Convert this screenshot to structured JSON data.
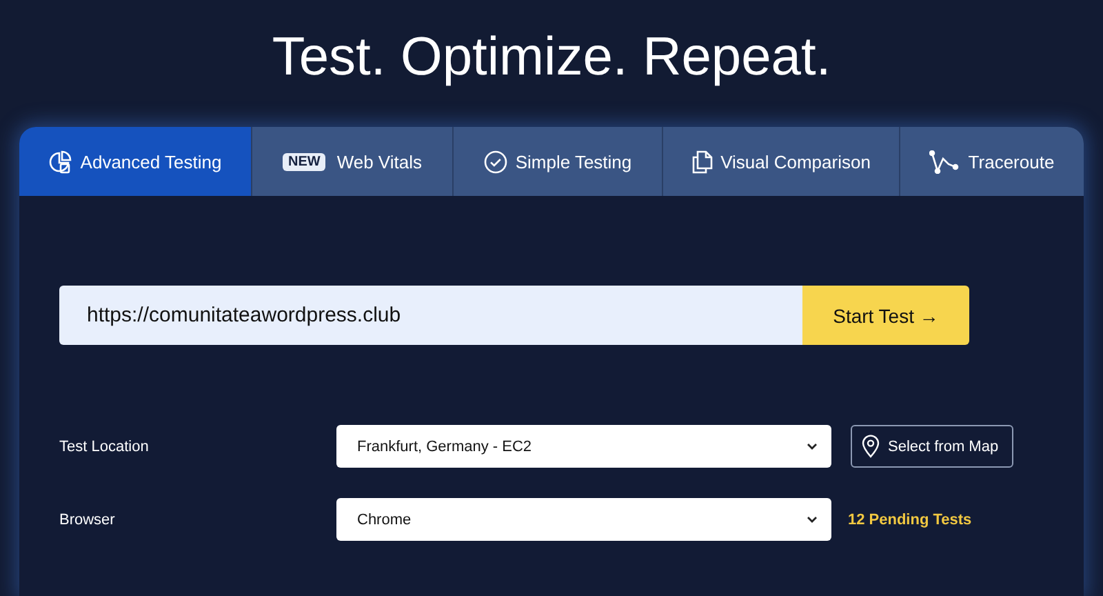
{
  "headline": "Test. Optimize. Repeat.",
  "tabs": [
    {
      "label": "Advanced Testing",
      "selected": true
    },
    {
      "label": "Web Vitals",
      "badge": "NEW",
      "selected": false
    },
    {
      "label": "Simple Testing",
      "selected": false
    },
    {
      "label": "Visual Comparison",
      "selected": false
    },
    {
      "label": "Traceroute",
      "selected": false
    }
  ],
  "url_field": {
    "value": "https://comunitateawordpress.club"
  },
  "start_button": "Start Test →",
  "settings": [
    {
      "label": "Test Location",
      "value": "Frankfurt, Germany - EC2",
      "extra": {
        "kind": "button",
        "text": "Select from Map"
      }
    },
    {
      "label": "Browser",
      "value": "Chrome",
      "extra": {
        "kind": "note",
        "text": "12 Pending Tests"
      }
    }
  ]
}
